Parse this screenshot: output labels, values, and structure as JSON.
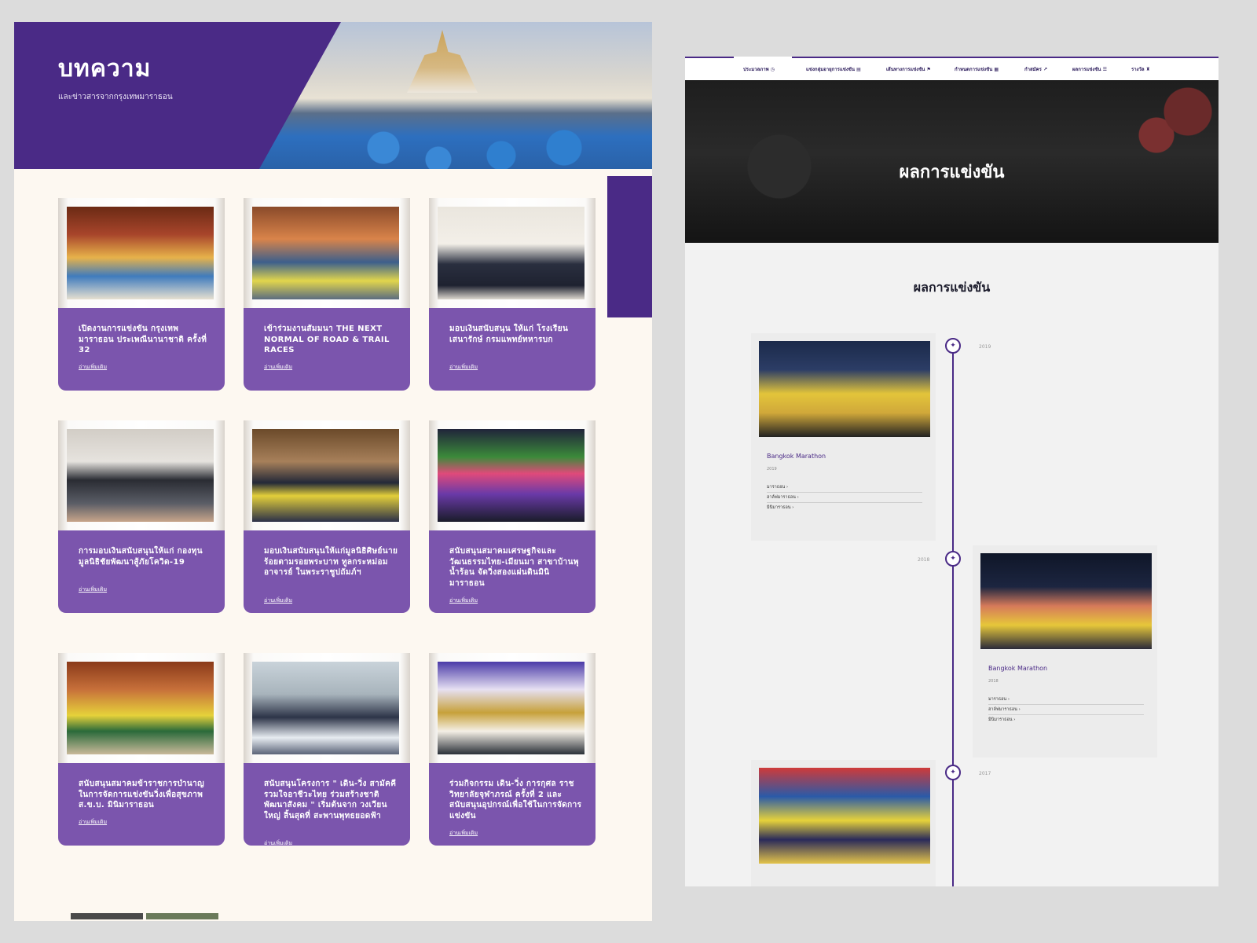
{
  "left": {
    "hero": {
      "title": "บทความ",
      "subtitle": "และข่าวสารจากกรุงเทพมาราธอน"
    },
    "articles": [
      {
        "title": "เปิดงานการแข่งขัน กรุงเทพมาราธอน ประเพณีนานาชาติ ครั้งที่ 32",
        "more": "อ่านเพิ่มเติม"
      },
      {
        "title": "เข้าร่วมงานสัมมนา THE NEXT NORMAL OF ROAD & TRAIL RACES",
        "more": "อ่านเพิ่มเติม"
      },
      {
        "title": "มอบเงินสนับสนุน ให้แก่ โรงเรียนเสนารักษ์ กรมแพทย์ทหารบก",
        "more": "อ่านเพิ่มเติม"
      },
      {
        "title": "การมอบเงินสนับสนุนให้แก่ กองทุนมูลนิธิชัยพัฒนาสู้ภัยโควิด-19",
        "more": "อ่านเพิ่มเติม"
      },
      {
        "title": "มอบเงินสนับสนุนให้แก่มูลนิธิศิษย์นายร้อยตามรอยพระบาท ทูลกระหม่อมอาจารย์ ในพระราชูปถัมภ์ฯ",
        "more": "อ่านเพิ่มเติม"
      },
      {
        "title": "สนับสนุนสมาคมเศรษฐกิจและวัฒนธรรมไทย-เมียนมา สาขาบ้านพุน้ำร้อน จัดวิ่งสองแผ่นดินมินิมาราธอน",
        "more": "อ่านเพิ่มเติม"
      },
      {
        "title": "สนับสนุนสมาคมข้าราชการบำนาญ ในการจัดการแข่งขันวิ่งเพื่อสุขภาพ ส.ข.บ. มินิมาราธอน",
        "more": "อ่านเพิ่มเติม"
      },
      {
        "title": "สนับสนุนโครงการ \" เดิน-วิ่ง สามัคคีรวมใจอาชีวะไทย ร่วมสร้างชาติพัฒนาสังคม \" เริ่มต้นจาก วงเวียนใหญ่ สิ้นสุดที่ สะพานพุทธยอดฟ้า",
        "more": "อ่านเพิ่มเติม"
      },
      {
        "title": "ร่วมกิจกรรม เดิน-วิ่ง การกุศล ราชวิทยาลัยจุฬาภรณ์ ครั้งที่ 2 และสนับสนุนอุปกรณ์เพื่อใช้ในการจัดการแข่งขัน",
        "more": "อ่านเพิ่มเติม"
      }
    ]
  },
  "right": {
    "nav": [
      {
        "label": "ประมวลภาพ",
        "icon": "clock-icon"
      },
      {
        "label": "แข่งกลุ่มอายุการแข่งขัน",
        "icon": "document-icon"
      },
      {
        "label": "เส้นทางการแข่งขัน",
        "icon": "flag-icon"
      },
      {
        "label": "กำหนดการแข่งขัน",
        "icon": "calendar-icon"
      },
      {
        "label": "กำสมัคร",
        "icon": "external-link-icon"
      },
      {
        "label": "ผลการแข่งขัน",
        "icon": "list-icon"
      },
      {
        "label": "รางวัล",
        "icon": "trophy-icon"
      }
    ],
    "banner_title": "ผลการแข่งขัน",
    "section_title": "ผลการแข่งขัน",
    "timeline": [
      {
        "year": "2019",
        "name": "Bangkok Marathon",
        "sub": "2019",
        "links": [
          "มาราธอน ›",
          "ฮาล์ฟมาราธอน ›",
          "มินิมาราธอน ›"
        ]
      },
      {
        "year": "2018",
        "name": "Bangkok Marathon",
        "sub": "2018",
        "links": [
          "มาราธอน ›",
          "ฮาล์ฟมาราธอน ›",
          "มินิมาราธอน ›"
        ]
      },
      {
        "year": "2017"
      }
    ]
  },
  "colors": {
    "brand_purple": "#4a2a86",
    "card_purple": "#7b55ad",
    "page_cream": "#fdf8f1"
  }
}
